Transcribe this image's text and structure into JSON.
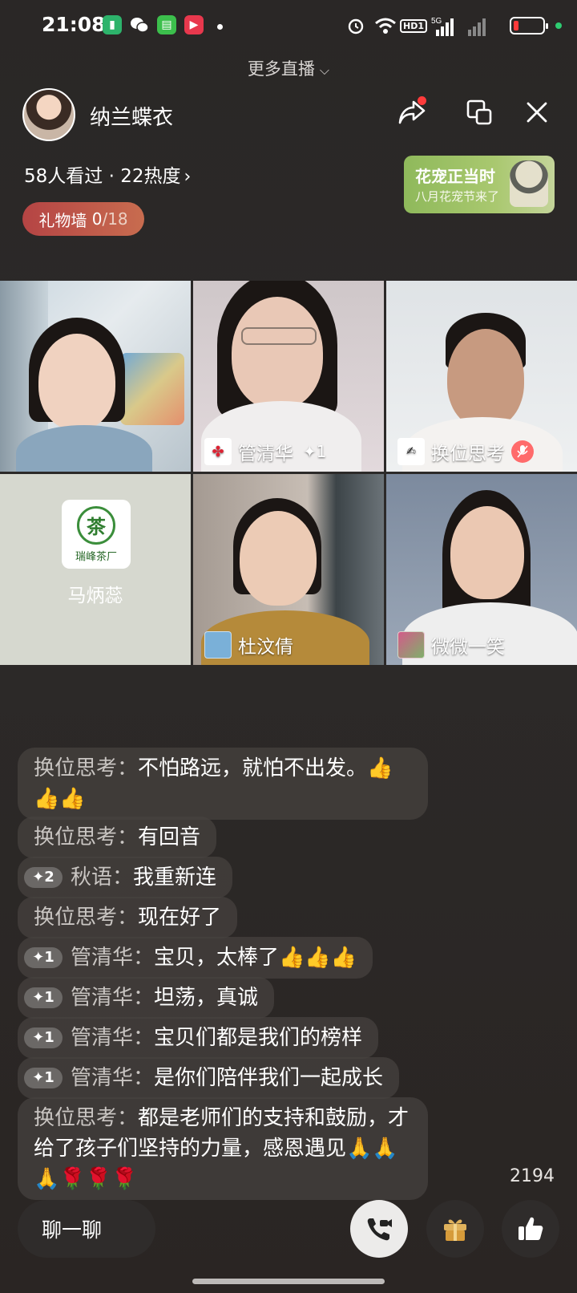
{
  "status_bar": {
    "time": "21:08",
    "network": "5G",
    "hd_label": "HD1",
    "icons": [
      "battery-saver-icon",
      "wechat-icon",
      "sim-icon",
      "video-app-icon",
      "alarm-icon",
      "wifi-icon",
      "signal-icon",
      "battery-icon"
    ]
  },
  "more_live": {
    "label": "更多直播"
  },
  "host": {
    "name": "纳兰蝶衣",
    "viewers_text": "58人看过 · 22热度"
  },
  "promo": {
    "title": "花宠正当时",
    "subtitle": "八月花宠节来了"
  },
  "gift_wall": {
    "label": "礼物墙",
    "current": "0",
    "total": "/18"
  },
  "video_grid": [
    {
      "name": "",
      "badge": ""
    },
    {
      "name": "管清华",
      "badge": "✦1"
    },
    {
      "name": "换位思考",
      "badge": ""
    },
    {
      "name": "马炳蕊",
      "badge": "",
      "logo_char": "茶",
      "logo_text": "瑞峰茶厂"
    },
    {
      "name": "杜汶倩",
      "badge": ""
    },
    {
      "name": "微微一笑",
      "badge": ""
    }
  ],
  "chat": [
    {
      "fan": "",
      "user": "换位思考：",
      "text": "不怕路远，就怕不出发。👍👍👍"
    },
    {
      "fan": "",
      "user": "换位思考：",
      "text": "有回音"
    },
    {
      "fan": "✦2",
      "user": "秋语：",
      "text": "我重新连"
    },
    {
      "fan": "",
      "user": "换位思考：",
      "text": "现在好了"
    },
    {
      "fan": "✦1",
      "user": "管清华：",
      "text": "宝贝，太棒了👍👍👍"
    },
    {
      "fan": "✦1",
      "user": "管清华：",
      "text": "坦荡，真诚"
    },
    {
      "fan": "✦1",
      "user": "管清华：",
      "text": "宝贝们都是我们的榜样"
    },
    {
      "fan": "✦1",
      "user": "管清华：",
      "text": "是你们陪伴我们一起成长"
    },
    {
      "fan": "",
      "user": "换位思考：",
      "text": "都是老师们的支持和鼓励，才给了孩子们坚持的力量，感恩遇见🙏🙏🙏🌹🌹🌹"
    }
  ],
  "like_count": "2194",
  "bottom_bar": {
    "chat_label": "聊一聊"
  }
}
